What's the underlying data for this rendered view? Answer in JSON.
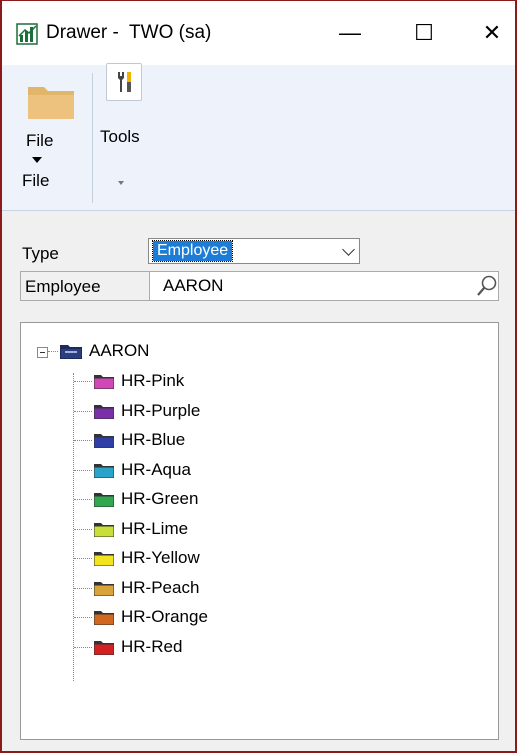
{
  "window": {
    "title": "Drawer -  TWO (sa)",
    "minimize_glyph": "—",
    "maximize_glyph": "☐",
    "close_glyph": "✕"
  },
  "ribbon": {
    "file_button_label": "File",
    "tools_button_label": "Tools",
    "group_file_label": "File"
  },
  "form": {
    "type_label": "Type",
    "type_value": "Employee",
    "employee_label": "Employee",
    "employee_value": "AARON"
  },
  "tree": {
    "root": {
      "label": "AARON",
      "icon": "drawer-icon"
    },
    "children": [
      {
        "label": "HR-Pink",
        "color": "#d147b5"
      },
      {
        "label": "HR-Purple",
        "color": "#7b2fa8"
      },
      {
        "label": "HR-Blue",
        "color": "#2e3fa8"
      },
      {
        "label": "HR-Aqua",
        "color": "#29a3c8"
      },
      {
        "label": "HR-Green",
        "color": "#2fa84f"
      },
      {
        "label": "HR-Lime",
        "color": "#c9de3a"
      },
      {
        "label": "HR-Yellow",
        "color": "#f2e21f"
      },
      {
        "label": "HR-Peach",
        "color": "#d9a23a"
      },
      {
        "label": "HR-Orange",
        "color": "#d2671f"
      },
      {
        "label": "HR-Red",
        "color": "#d42020"
      }
    ]
  }
}
